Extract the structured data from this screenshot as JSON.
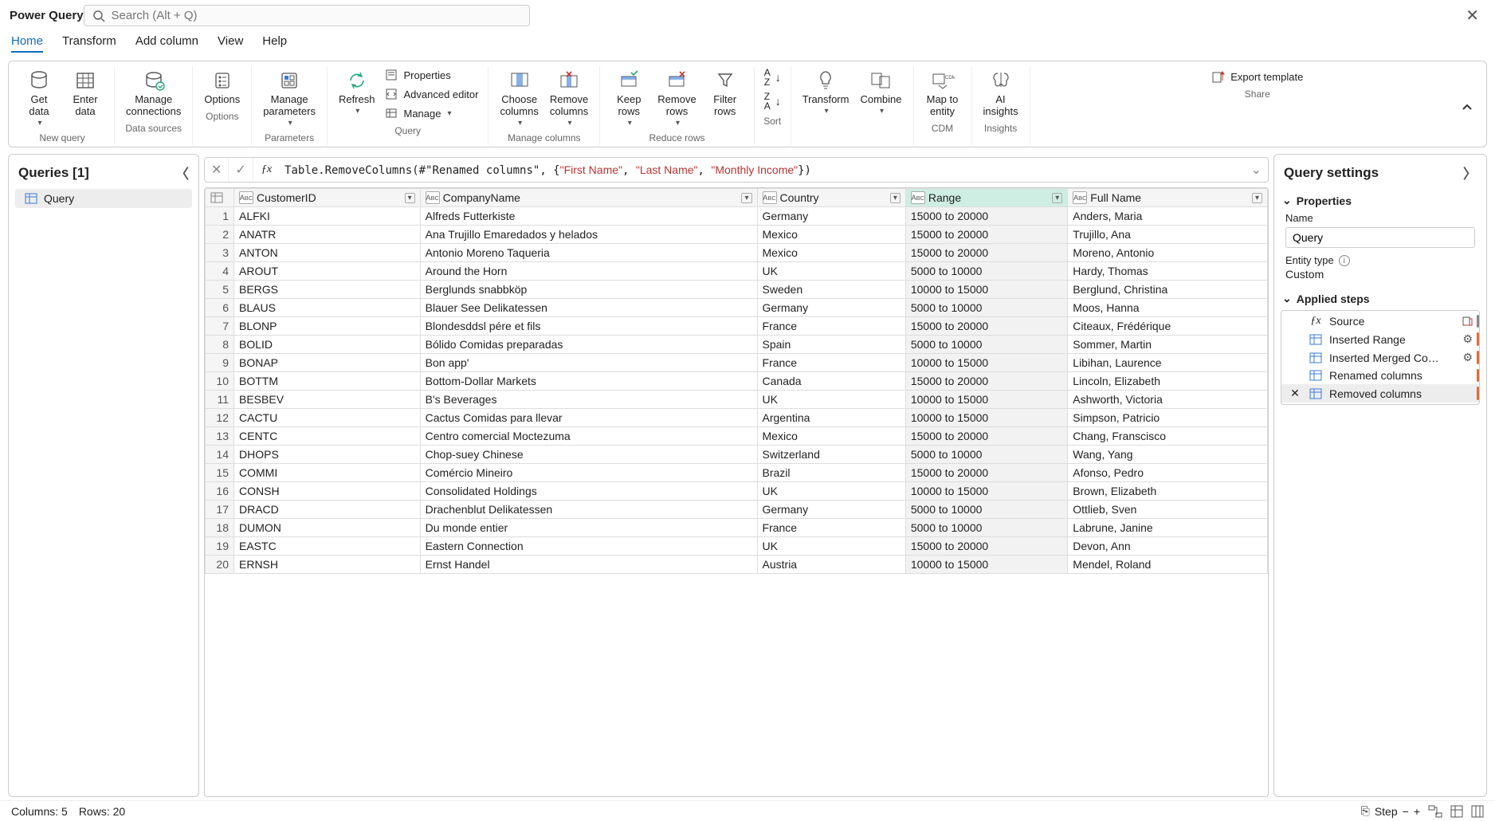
{
  "app_title": "Power Query",
  "search": {
    "placeholder": "Search (Alt + Q)"
  },
  "menu": {
    "tabs": [
      "Home",
      "Transform",
      "Add column",
      "View",
      "Help"
    ],
    "active": 0
  },
  "ribbon": {
    "btn_get_data": "Get\ndata",
    "btn_enter_data": "Enter\ndata",
    "grp_new_query": "New query",
    "btn_manage_conn": "Manage\nconnections",
    "grp_data_sources": "Data sources",
    "btn_options": "Options",
    "grp_options": "Options",
    "btn_manage_params": "Manage\nparameters",
    "grp_parameters": "Parameters",
    "btn_refresh": "Refresh",
    "btn_properties": "Properties",
    "btn_adv_editor": "Advanced editor",
    "btn_manage": "Manage",
    "grp_query": "Query",
    "btn_choose_cols": "Choose\ncolumns",
    "btn_remove_cols": "Remove\ncolumns",
    "grp_manage_cols": "Manage columns",
    "btn_keep_rows": "Keep\nrows",
    "btn_remove_rows": "Remove\nrows",
    "btn_filter_rows": "Filter\nrows",
    "grp_reduce_rows": "Reduce rows",
    "grp_sort": "Sort",
    "btn_transform": "Transform",
    "btn_combine": "Combine",
    "btn_map_entity": "Map to\nentity",
    "grp_cdm": "CDM",
    "btn_ai": "AI\ninsights",
    "grp_insights": "Insights",
    "btn_export": "Export template",
    "grp_share": "Share"
  },
  "queries": {
    "title": "Queries [1]",
    "items": [
      "Query"
    ]
  },
  "formula": {
    "fn": "Table.RemoveColumns",
    "arg1": "#\"Renamed columns\"",
    "strs": [
      "\"First Name\"",
      "\"Last Name\"",
      "\"Monthly Income\""
    ]
  },
  "columns": [
    "CustomerID",
    "CompanyName",
    "Country",
    "Range",
    "Full Name"
  ],
  "selected_col_index": 3,
  "rows": [
    [
      "ALFKI",
      "Alfreds Futterkiste",
      "Germany",
      "15000 to 20000",
      "Anders, Maria"
    ],
    [
      "ANATR",
      "Ana Trujillo Emaredados y helados",
      "Mexico",
      "15000 to 20000",
      "Trujillo, Ana"
    ],
    [
      "ANTON",
      "Antonio Moreno Taqueria",
      "Mexico",
      "15000 to 20000",
      "Moreno, Antonio"
    ],
    [
      "AROUT",
      "Around the Horn",
      "UK",
      "5000 to 10000",
      "Hardy, Thomas"
    ],
    [
      "BERGS",
      "Berglunds snabbköp",
      "Sweden",
      "10000 to 15000",
      "Berglund, Christina"
    ],
    [
      "BLAUS",
      "Blauer See Delikatessen",
      "Germany",
      "5000 to 10000",
      "Moos, Hanna"
    ],
    [
      "BLONP",
      "Blondesddsl pére et fils",
      "France",
      "15000 to 20000",
      "Citeaux, Frédérique"
    ],
    [
      "BOLID",
      "Bólido Comidas preparadas",
      "Spain",
      "5000 to 10000",
      "Sommer, Martin"
    ],
    [
      "BONAP",
      "Bon app'",
      "France",
      "10000 to 15000",
      "Libihan, Laurence"
    ],
    [
      "BOTTM",
      "Bottom-Dollar Markets",
      "Canada",
      "15000 to 20000",
      "Lincoln, Elizabeth"
    ],
    [
      "BESBEV",
      "B's Beverages",
      "UK",
      "10000 to 15000",
      "Ashworth, Victoria"
    ],
    [
      "CACTU",
      "Cactus Comidas para llevar",
      "Argentina",
      "10000 to 15000",
      "Simpson, Patricio"
    ],
    [
      "CENTC",
      "Centro comercial Moctezuma",
      "Mexico",
      "15000 to 20000",
      "Chang, Franscisco"
    ],
    [
      "DHOPS",
      "Chop-suey Chinese",
      "Switzerland",
      "5000 to 10000",
      "Wang, Yang"
    ],
    [
      "COMMI",
      "Comércio Mineiro",
      "Brazil",
      "15000 to 20000",
      "Afonso, Pedro"
    ],
    [
      "CONSH",
      "Consolidated Holdings",
      "UK",
      "10000 to 15000",
      "Brown, Elizabeth"
    ],
    [
      "DRACD",
      "Drachenblut Delikatessen",
      "Germany",
      "5000 to 10000",
      "Ottlieb, Sven"
    ],
    [
      "DUMON",
      "Du monde entier",
      "France",
      "5000 to 10000",
      "Labrune, Janine"
    ],
    [
      "EASTC",
      "Eastern Connection",
      "UK",
      "15000 to 20000",
      "Devon, Ann"
    ],
    [
      "ERNSH",
      "Ernst Handel",
      "Austria",
      "10000 to 15000",
      "Mendel, Roland"
    ]
  ],
  "settings": {
    "title": "Query settings",
    "properties": "Properties",
    "name_label": "Name",
    "name_value": "Query",
    "entity_type_label": "Entity type",
    "entity_type_value": "Custom",
    "applied_steps": "Applied steps",
    "steps": [
      {
        "label": "Source",
        "gear": false,
        "left": "fx",
        "special": true
      },
      {
        "label": "Inserted Range",
        "gear": true,
        "left": "tbl"
      },
      {
        "label": "Inserted Merged Co…",
        "gear": true,
        "left": "tbl"
      },
      {
        "label": "Renamed columns",
        "gear": false,
        "left": "ren"
      },
      {
        "label": "Removed columns",
        "gear": false,
        "left": "rem"
      }
    ],
    "selected_step": 4
  },
  "status": {
    "cols": "Columns: 5",
    "rows": "Rows: 20",
    "step": "Step"
  }
}
